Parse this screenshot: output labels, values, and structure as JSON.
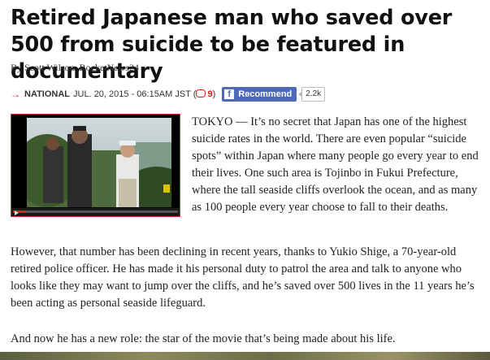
{
  "article": {
    "headline": "Retired Japanese man who saved over 500 from suicide to be featured in documentary",
    "byline": "By Scott Wilson, RocketNews24",
    "meta": {
      "section": "NATIONAL",
      "date": "JUL. 20, 2015 - 06:15AM JST (",
      "comment_count": "9",
      "close_paren": ")"
    },
    "facebook": {
      "recommend_label": "Recommend",
      "count": "2.2k"
    },
    "intro_paragraph": "TOKYO — It’s no secret that Japan has one of the highest suicide rates in the world. There are even popular “suicide spots” within Japan where many people go every year to end their lives. One such area is Tojinbo in Fukui Prefecture, where the tall seaside cliffs overlook the ocean, and as many as 100 people every year choose to fall to their deaths.",
    "paragraph_2": "However, that number has been declining in recent years, thanks to Yukio Shige, a 70-year-old retired police officer. He has made it his personal duty to patrol the area and talk to anyone who looks like they may want to jump over the cliffs, and he’s saved over 500 lives in the 11 years he’s been acting as personal seaside lifeguard.",
    "paragraph_3": "And now he has a new role: the star of the movie that’s being made about his life."
  },
  "video": {
    "progress_fraction": 0.08
  },
  "colors": {
    "accent_red": "#dd2211",
    "facebook_blue": "#4c69ba"
  }
}
